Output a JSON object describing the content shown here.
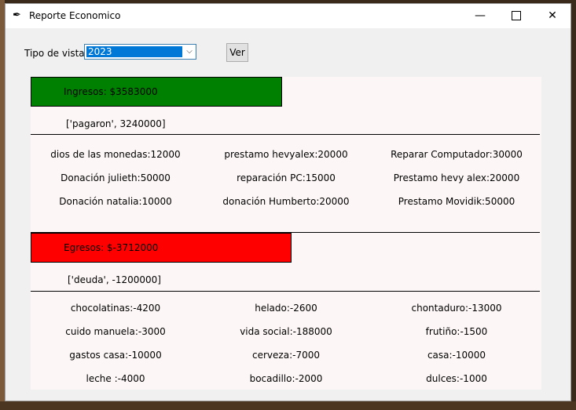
{
  "window": {
    "title": "Reporte Economico",
    "app_icon": "feather-icon"
  },
  "controls": {
    "view_label": "Tipo de vista:",
    "view_select_value": "2023",
    "view_button_label": "Ver"
  },
  "income": {
    "label": "Ingresos: $3583000",
    "color": "#008000",
    "summary": "['pagaron', 3240000]",
    "items": [
      "dios de las monedas:12000",
      "prestamo hevyalex:20000",
      "Reparar Computador:30000",
      "Donación julieth:50000",
      "reparación PC:15000",
      "Prestamo hevy alex:20000",
      "Donación natalia:10000",
      "donación Humberto:20000",
      "Prestamo Movidik:50000"
    ]
  },
  "expenses": {
    "label": "Egresos: $-3712000",
    "color": "#ff0000",
    "summary": "['deuda', -1200000]",
    "items": [
      "chocolatinas:-4200",
      "helado:-2600",
      "chontaduro:-13000",
      "cuido manuela:-3000",
      "vida social:-188000",
      "frutiño:-1500",
      "gastos casa:-10000",
      "cerveza:-7000",
      "casa:-10000",
      "leche :-4000",
      "bocadillo:-2000",
      "dulces:-1000"
    ]
  }
}
